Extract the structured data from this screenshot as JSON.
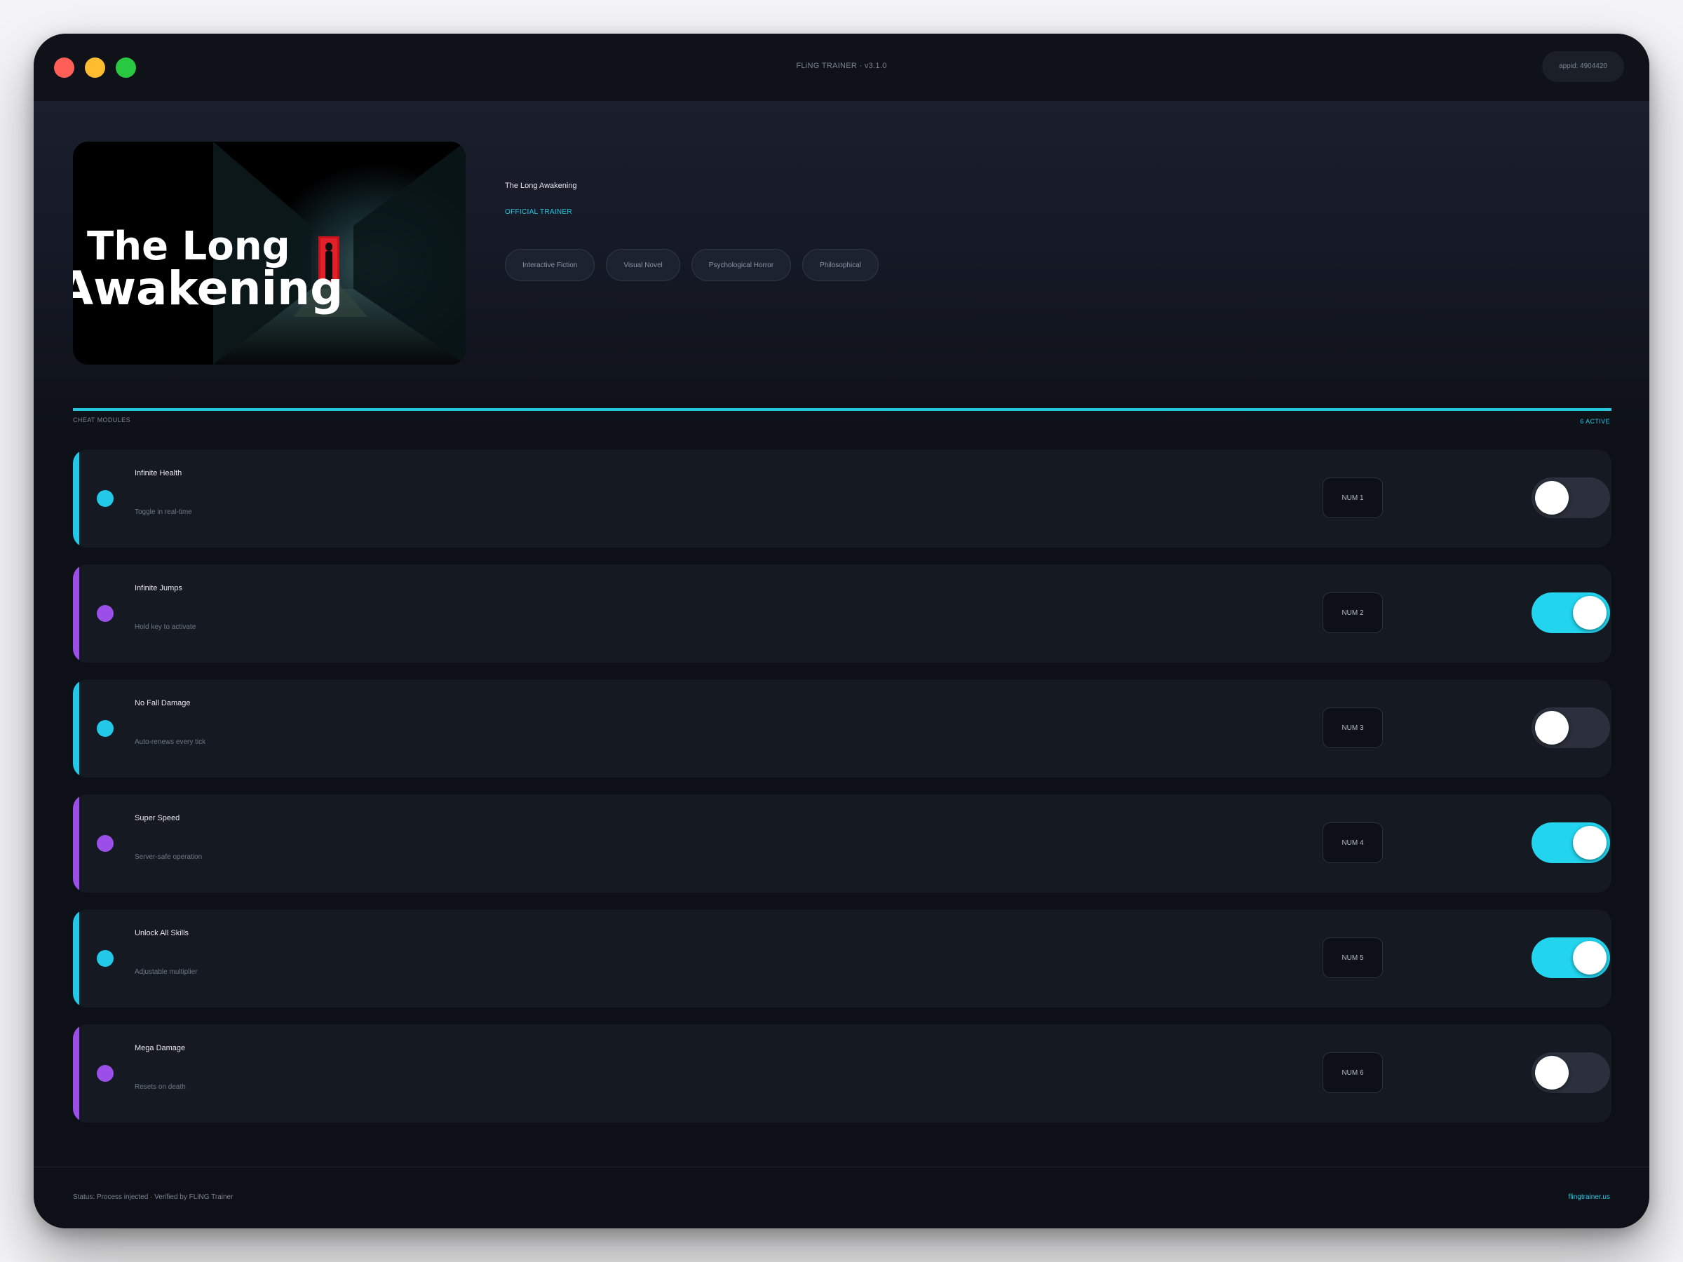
{
  "window": {
    "title": "FLiNG TRAINER · v3.1.0",
    "appid": "appid: 4904420"
  },
  "game": {
    "title": "The Long Awakening",
    "badge": "OFFICIAL TRAINER",
    "cover_text_line1": "The Long",
    "cover_text_line2": "Awakening",
    "tags": [
      "Interactive Fiction",
      "Visual Novel",
      "Psychological Horror",
      "Philosophical"
    ]
  },
  "section": {
    "label": "CHEAT MODULES",
    "count": "6 ACTIVE"
  },
  "modules": [
    {
      "name": "Infinite Health",
      "desc": "Toggle in real-time",
      "hotkey": "NUM 1",
      "enabled": false,
      "color": "#22c8e8"
    },
    {
      "name": "Infinite Jumps",
      "desc": "Hold key to activate",
      "hotkey": "NUM 2",
      "enabled": true,
      "color": "#9b4fe8"
    },
    {
      "name": "No Fall Damage",
      "desc": "Auto-renews every tick",
      "hotkey": "NUM 3",
      "enabled": false,
      "color": "#22c8e8"
    },
    {
      "name": "Super Speed",
      "desc": "Server-safe operation",
      "hotkey": "NUM 4",
      "enabled": true,
      "color": "#9b4fe8"
    },
    {
      "name": "Unlock All Skills",
      "desc": "Adjustable multiplier",
      "hotkey": "NUM 5",
      "enabled": true,
      "color": "#22c8e8"
    },
    {
      "name": "Mega Damage",
      "desc": "Resets on death",
      "hotkey": "NUM 6",
      "enabled": false,
      "color": "#9b4fe8"
    }
  ],
  "footer": {
    "status": "Status: Process injected · Verified by FLiNG Trainer",
    "site": "flingtrainer.us"
  },
  "colors": {
    "accent_cyan": "#22c8e8",
    "accent_purple": "#9b4fe8",
    "background": "#0d1016",
    "card": "#151922"
  }
}
